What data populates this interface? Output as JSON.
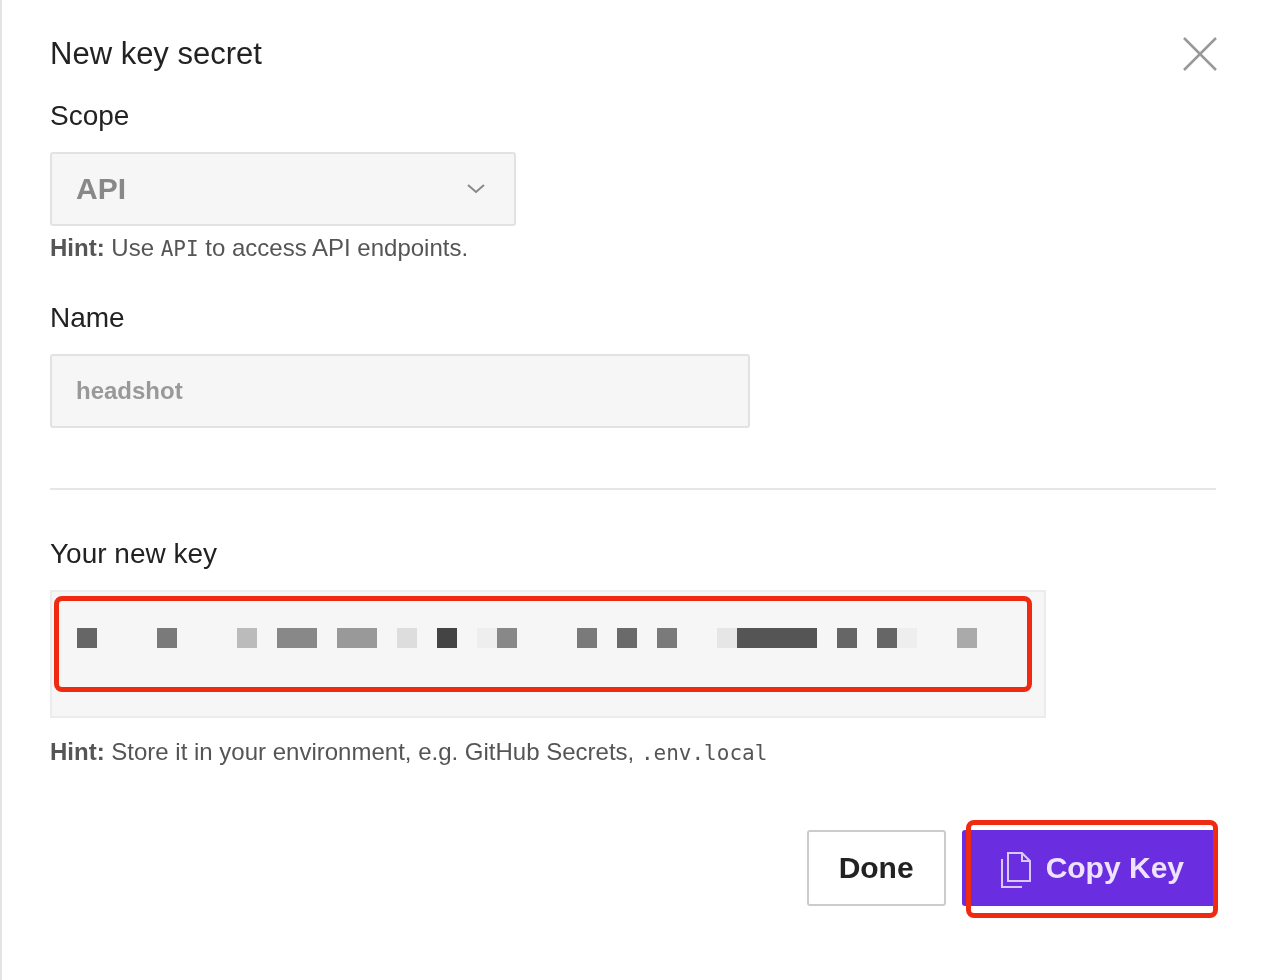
{
  "dialog": {
    "title": "New key secret"
  },
  "scope": {
    "label": "Scope",
    "value": "API",
    "hint": [
      {
        "kind": "bold",
        "text": "Hint:"
      },
      {
        "kind": "plain",
        "text": " Use "
      },
      {
        "kind": "code",
        "text": "API"
      },
      {
        "kind": "plain",
        "text": " to access API endpoints."
      }
    ]
  },
  "name": {
    "label": "Name",
    "placeholder": "headshot"
  },
  "new_key": {
    "label": "Your new key",
    "highlighted": true,
    "hint": [
      {
        "kind": "bold",
        "text": "Hint:"
      },
      {
        "kind": "plain",
        "text": " Store it in your environment, e.g. GitHub Secrets, "
      },
      {
        "kind": "code",
        "text": ".env.local"
      }
    ]
  },
  "buttons": [
    {
      "label": "Done",
      "kind": "secondary",
      "highlighted": false
    },
    {
      "label": "Copy Key",
      "kind": "primary",
      "highlighted": true
    }
  ]
}
